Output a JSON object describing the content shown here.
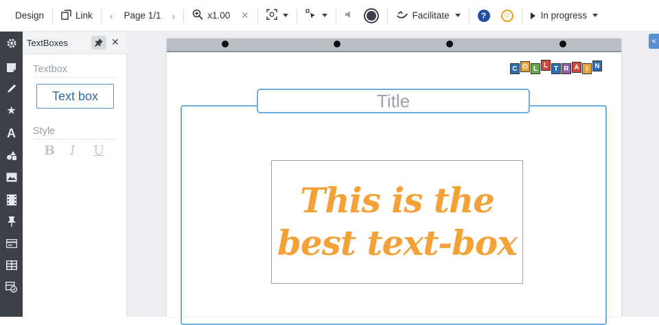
{
  "toolbar": {
    "design_label": "Design",
    "link_label": "Link",
    "page_label": "Page 1/1",
    "zoom_label": "x1.00",
    "facilitate_label": "Facilitate",
    "help_label": "?",
    "status_label": "In progress"
  },
  "panel": {
    "title": "TextBoxes",
    "section_textbox": "Textbox",
    "textbox_tool_label": "Text box",
    "section_style": "Style",
    "bold_label": "B",
    "italic_label": "I",
    "underline_label": "U"
  },
  "canvas": {
    "logo_letters": [
      "C",
      "O",
      "L",
      "L",
      "T",
      "R",
      "A",
      "I",
      "N"
    ],
    "logo_colors": [
      "#2f6db3",
      "#e8a33a",
      "#6aa84f",
      "#d04a3a",
      "#2f6db3",
      "#8e5ea2",
      "#d04a3a",
      "#e8a33a",
      "#2f6db3"
    ],
    "title_placeholder": "Title",
    "textbox_line1": "This is the",
    "textbox_line2": "best text-box"
  },
  "colors": {
    "accent": "#6aaee0",
    "text_orange": "#f4a238",
    "sidebar_bg": "#3c4148"
  }
}
